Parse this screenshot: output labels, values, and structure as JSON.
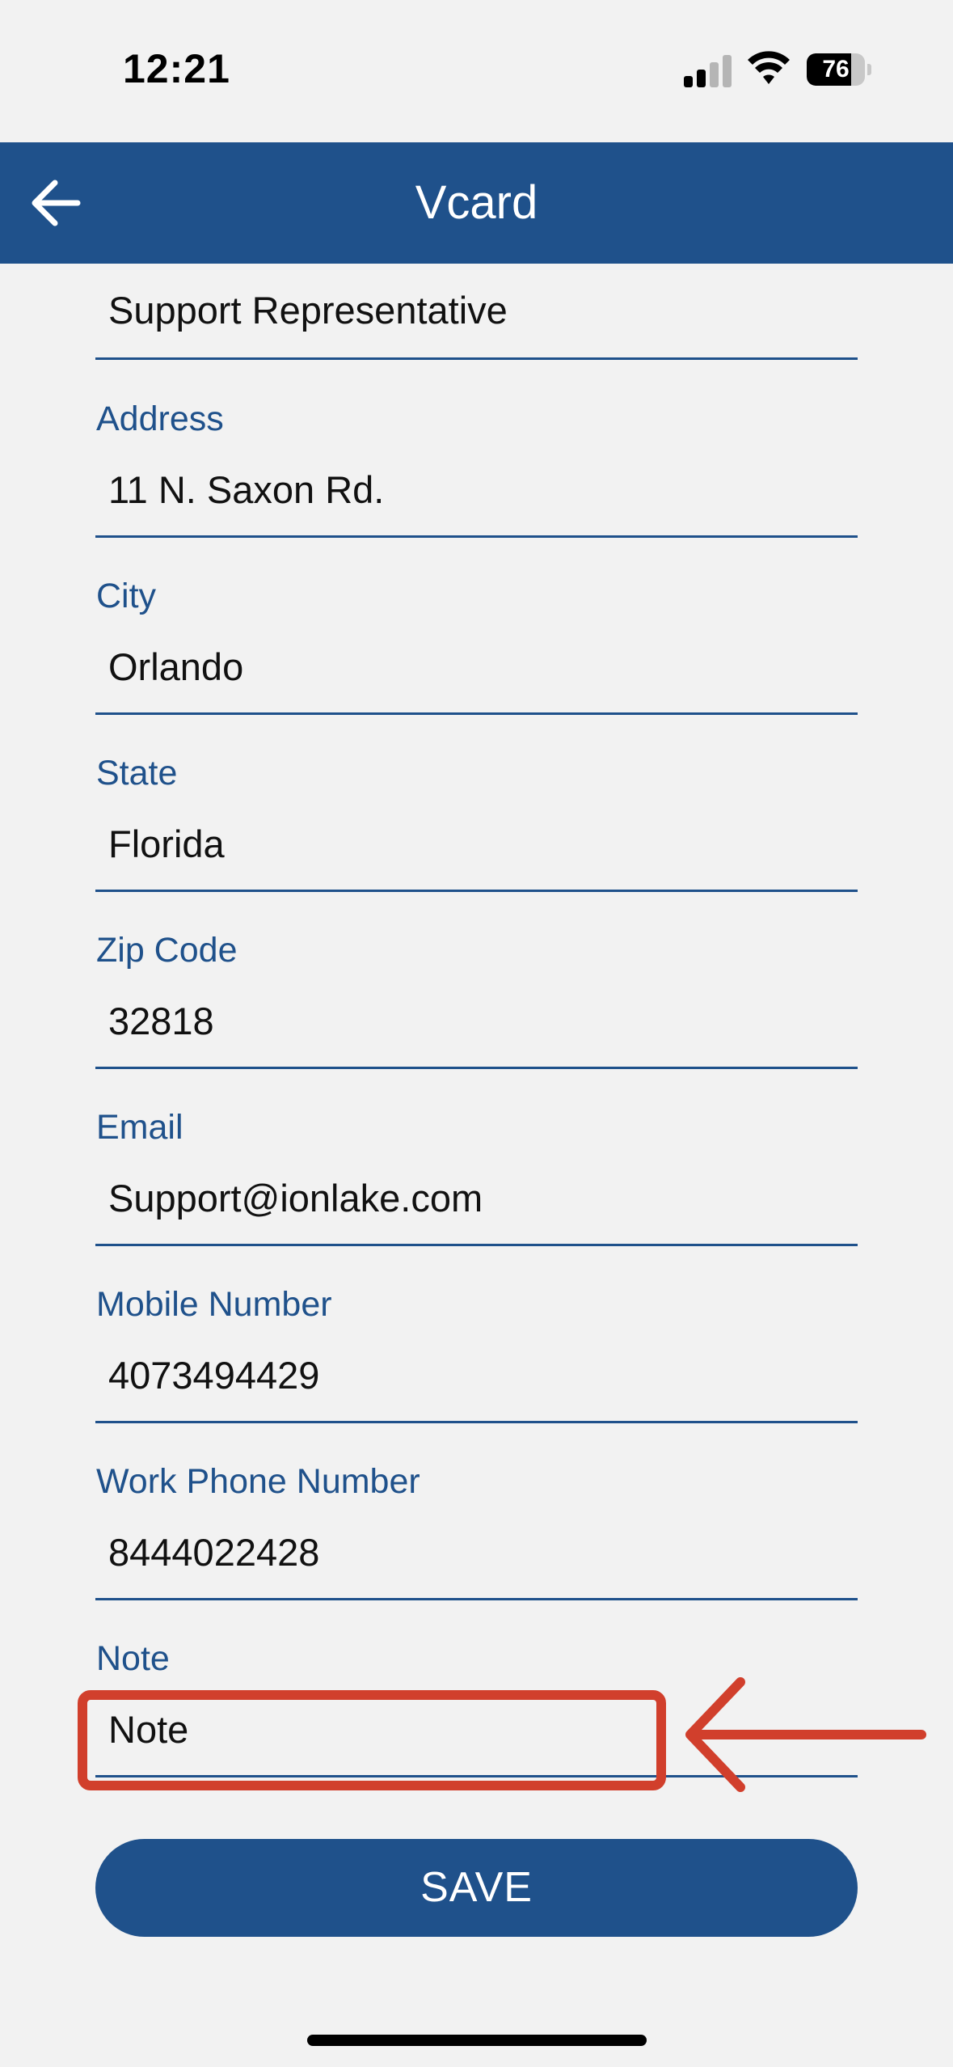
{
  "status_bar": {
    "time": "12:21",
    "battery_level": 76,
    "battery_text": "76",
    "signal_bars_active": 2,
    "signal_bars_total": 4,
    "icons": [
      "signal-icon",
      "wifi-icon",
      "battery-icon"
    ]
  },
  "header": {
    "title": "Vcard",
    "back_icon": "back-arrow-icon",
    "background": "#1f518b"
  },
  "form": {
    "title_field": {
      "value": "Support Representative"
    },
    "address": {
      "label": "Address",
      "value": "11 N. Saxon Rd."
    },
    "city": {
      "label": "City",
      "value": "Orlando"
    },
    "state": {
      "label": "State",
      "value": "Florida"
    },
    "zip": {
      "label": "Zip Code",
      "value": "32818"
    },
    "email": {
      "label": "Email",
      "value": "Support@ionlake.com"
    },
    "mobile": {
      "label": "Mobile Number",
      "value": "4073494429"
    },
    "work_phone": {
      "label": "Work Phone Number",
      "value": "8444022428"
    },
    "note": {
      "label": "Note",
      "placeholder": "Note",
      "value": ""
    }
  },
  "save_label": "SAVE",
  "colors": {
    "accent": "#1f518b",
    "annotation": "#d13f2c",
    "background": "#f2f2f2"
  }
}
